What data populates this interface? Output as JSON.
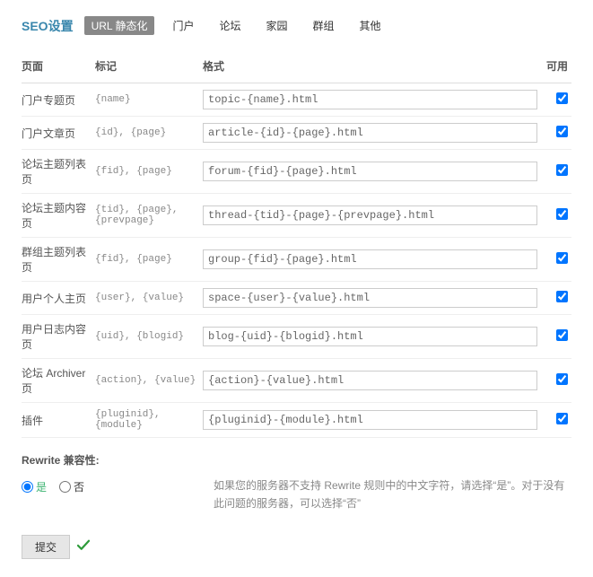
{
  "header": {
    "title": "SEO设置",
    "tabs": [
      "URL 静态化",
      "门户",
      "论坛",
      "家园",
      "群组",
      "其他"
    ]
  },
  "table": {
    "headers": {
      "page": "页面",
      "tag": "标记",
      "format": "格式",
      "available": "可用"
    },
    "rows": [
      {
        "page": "门户专题页",
        "tag": "{name}",
        "format": "topic-{name}.html"
      },
      {
        "page": "门户文章页",
        "tag": "{id}, {page}",
        "format": "article-{id}-{page}.html"
      },
      {
        "page": "论坛主题列表页",
        "tag": "{fid}, {page}",
        "format": "forum-{fid}-{page}.html"
      },
      {
        "page": "论坛主题内容页",
        "tag": "{tid}, {page}, {prevpage}",
        "format": "thread-{tid}-{page}-{prevpage}.html"
      },
      {
        "page": "群组主题列表页",
        "tag": "{fid}, {page}",
        "format": "group-{fid}-{page}.html"
      },
      {
        "page": "用户个人主页",
        "tag": "{user}, {value}",
        "format": "space-{user}-{value}.html"
      },
      {
        "page": "用户日志内容页",
        "tag": "{uid}, {blogid}",
        "format": "blog-{uid}-{blogid}.html"
      },
      {
        "page": "论坛 Archiver 页",
        "tag": "{action}, {value}",
        "format": "{action}-{value}.html"
      },
      {
        "page": "插件",
        "tag": "{pluginid}, {module}",
        "format": "{pluginid}-{module}.html"
      }
    ]
  },
  "rewrite": {
    "label": "Rewrite 兼容性:",
    "yes": "是",
    "no": "否",
    "hint": "如果您的服务器不支持 Rewrite 规则中的中文字符，请选择“是”。对于没有此问题的服务器，可以选择“否”"
  },
  "submit": {
    "label": "提交"
  }
}
